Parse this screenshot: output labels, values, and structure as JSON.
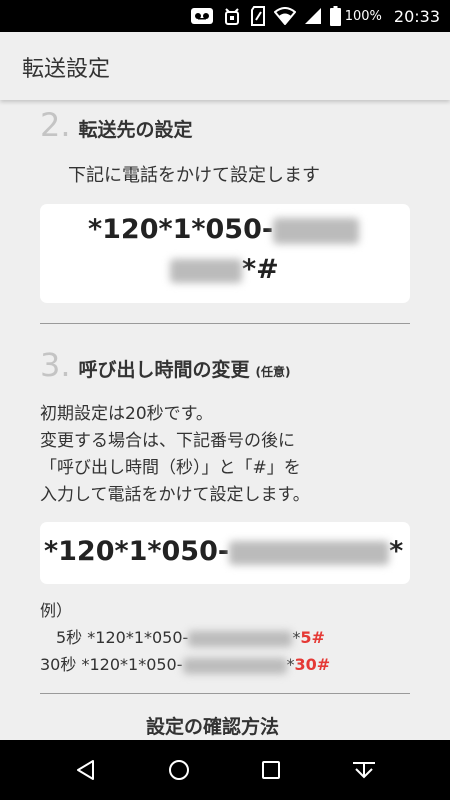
{
  "status_bar": {
    "battery_pct": "100%",
    "time": "20:33",
    "icons": [
      "voicemail-icon",
      "android-debug-icon",
      "sim-icon",
      "wifi-icon",
      "signal-icon",
      "battery-icon"
    ]
  },
  "app_bar": {
    "title": "転送設定"
  },
  "section2": {
    "num": "2.",
    "title": "転送先の設定",
    "instruction": "下記に電話をかけて設定します",
    "code_line1": "*120*1*050-",
    "code_line2_suffix": "*#"
  },
  "section3": {
    "num": "3.",
    "title": "呼び出し時間の変更",
    "note": "(任意)",
    "desc_line1": "初期設定は20秒です。",
    "desc_line2": "変更する場合は、下記番号の後に",
    "desc_line3": "「呼び出し時間（秒）」と「#」を",
    "desc_line4": "入力して電話をかけて設定します。",
    "code_prefix": "*120*1*050-",
    "code_suffix": "*"
  },
  "examples": {
    "label": "例）",
    "items": [
      {
        "seconds": "5秒",
        "code": "*120*1*050-",
        "suffix": "*",
        "value": "5#"
      },
      {
        "seconds": "30秒",
        "code": "*120*1*050-",
        "suffix": "*",
        "value": "30#"
      }
    ]
  },
  "section_confirm": {
    "title": "設定の確認方法"
  },
  "nav": [
    "back-icon",
    "home-icon",
    "recents-icon",
    "keyboard-hide-icon"
  ]
}
